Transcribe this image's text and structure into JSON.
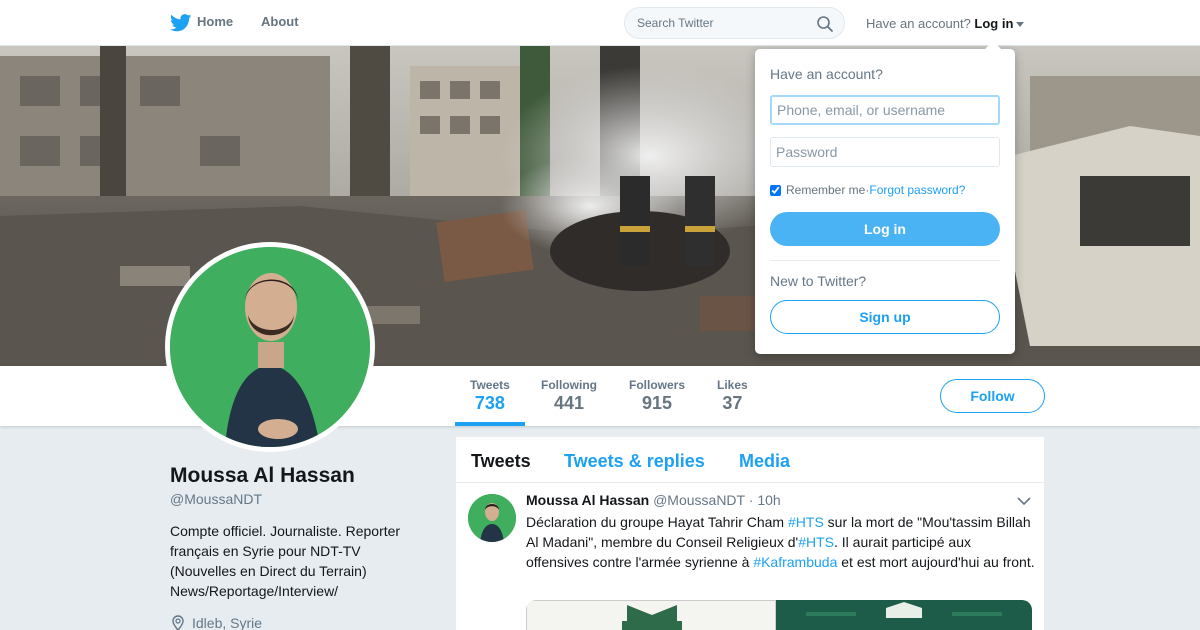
{
  "colors": {
    "brand": "#1da1f2",
    "login_button": "#4ab3f4",
    "page_bg": "#e6ecf0"
  },
  "nav": {
    "home_label": "Home",
    "about_label": "About",
    "search_placeholder": "Search Twitter",
    "have_account": "Have an account?",
    "login_label": "Log in"
  },
  "login_dropdown": {
    "title": "Have an account?",
    "username_placeholder": "Phone, email, or username",
    "password_placeholder": "Password",
    "remember_label": "Remember me",
    "separator": " · ",
    "forgot_label": "Forgot password?",
    "remember_checked": true,
    "login_button": "Log in",
    "new_prompt": "New to Twitter?",
    "signup_button": "Sign up"
  },
  "profile_nav": {
    "stats": [
      {
        "label": "Tweets",
        "value": "738"
      },
      {
        "label": "Following",
        "value": "441"
      },
      {
        "label": "Followers",
        "value": "915"
      },
      {
        "label": "Likes",
        "value": "37"
      }
    ],
    "follow_label": "Follow"
  },
  "profile": {
    "name": "Moussa Al Hassan",
    "handle": "@MoussaNDT",
    "bio": "Compte officiel. Journaliste. Reporter français en Syrie pour NDT-TV (Nouvelles en Direct du Terrain) News/Reportage/Interview/",
    "location": "Idleb, Syrie"
  },
  "timeline": {
    "tabs": [
      "Tweets",
      "Tweets & replies",
      "Media"
    ],
    "tweet": {
      "name": "Moussa Al Hassan",
      "handle": "@MoussaNDT",
      "time_sep": " · ",
      "time": "10h",
      "text_parts": {
        "p1": "Déclaration du groupe Hayat Tahrir Cham ",
        "h1": "#HTS",
        "p2": " sur la mort de \"Mou'tassim Billah Al Madani\", membre du Conseil Religieux d'",
        "h2": "#HTS",
        "p3": ". Il aurait participé aux offensives contre l'armée syrienne à ",
        "h3": "#Kaframbuda",
        "p4": " et est mort aujourd'hui au front."
      }
    }
  }
}
